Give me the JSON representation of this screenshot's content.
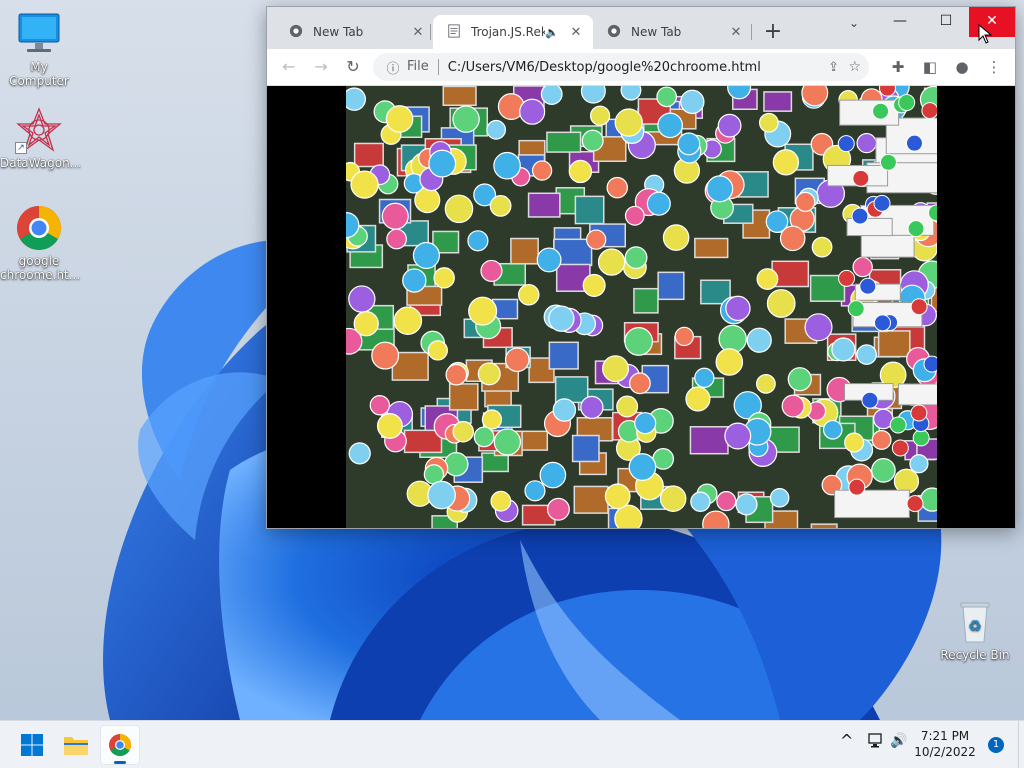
{
  "desktop": {
    "icons": [
      {
        "label": "My Computer"
      },
      {
        "label": "DataWagon..."
      },
      {
        "label": "google chroome.ht..."
      },
      {
        "label": "Recycle Bin"
      }
    ]
  },
  "browser": {
    "tabs": [
      {
        "title": "New Tab",
        "active": false
      },
      {
        "title": "Trojan.JS.Rekt",
        "active": true,
        "audio": true
      },
      {
        "title": "New Tab",
        "active": false
      }
    ],
    "new_tab_label": "+",
    "omnibox": {
      "scheme": "File",
      "url": "C:/Users/VM6/Desktop/google%20chroome.html"
    },
    "window_controls": {
      "minimize": "—",
      "maximize": "☐",
      "close": "✕"
    }
  },
  "taskbar": {
    "time": "7:21 PM",
    "date": "10/2/2022",
    "notification_count": "1"
  },
  "colors": {
    "accent": "#0067c0",
    "close_red": "#e81123",
    "tabstrip": "#dee1e6"
  },
  "icons": {
    "back": "arrow-left-icon",
    "forward": "arrow-right-icon",
    "reload": "reload-icon",
    "info": "info-icon",
    "share": "share-icon",
    "star": "star-icon",
    "extensions": "puzzle-icon",
    "sidepanel": "sidepanel-icon",
    "profile": "profile-icon",
    "menu": "kebab-menu-icon"
  }
}
